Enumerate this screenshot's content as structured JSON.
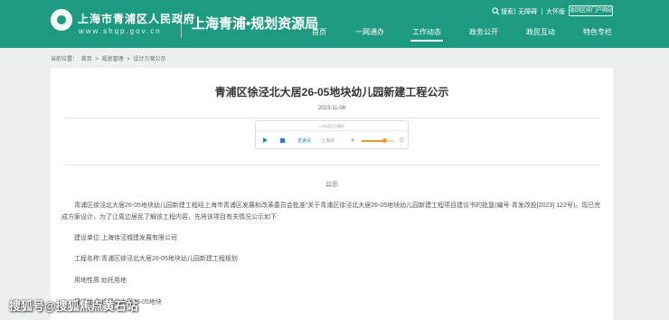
{
  "header": {
    "gov_title": "上海市青浦区人民政府",
    "gov_url": "www.shqp.gov.cn",
    "bureau_title": "上海青浦•规划资源局",
    "utils": {
      "search": "搜索",
      "accessibility": "无障碍",
      "big_font": "大怀版",
      "portal": "返回区府门户网站"
    },
    "nav": [
      "首页",
      "一网通办",
      "工作动态",
      "政务公开",
      "政民互动",
      "特色专栏"
    ],
    "active_nav": "工作动态",
    "brand_color": "#1f9a82"
  },
  "breadcrumb": [
    "当前位置：",
    "首页",
    ">",
    "规划管理",
    ">",
    "设计方案公示"
  ],
  "article": {
    "title": "青浦区徐泾北大居26-05地块幼儿园新建工程公示",
    "date": "2023-11-06",
    "player": {
      "top_text": "以听读后台播报",
      "speed": "音速设",
      "voice": "上海话",
      "volume_fraction": 0.7
    },
    "section_heading": "公示",
    "intro": "青浦区徐泾北大居26-05地块幼儿园新建工程经上海市青浦区发展和改革委员会批准“关于青浦区徐泾北大居26-05地块幼儿园新建工程项目建议书的批复(编号·青发改投[2023] 122号)。现已完成方案设计，为了让周边居民了解该工程内容，先将该项目有关情况公示如下:",
    "lines": [
      "建设单位:上海徐泾城建发展有限公司",
      "工程名称:青浦区徐泾北大居26-05地块幼儿园新建工程规划",
      "用地性质:幼托用地",
      "建设地点:徐泾北大居26-05地块"
    ]
  },
  "watermark": "搜狐号@搜狐焦点黄石站"
}
